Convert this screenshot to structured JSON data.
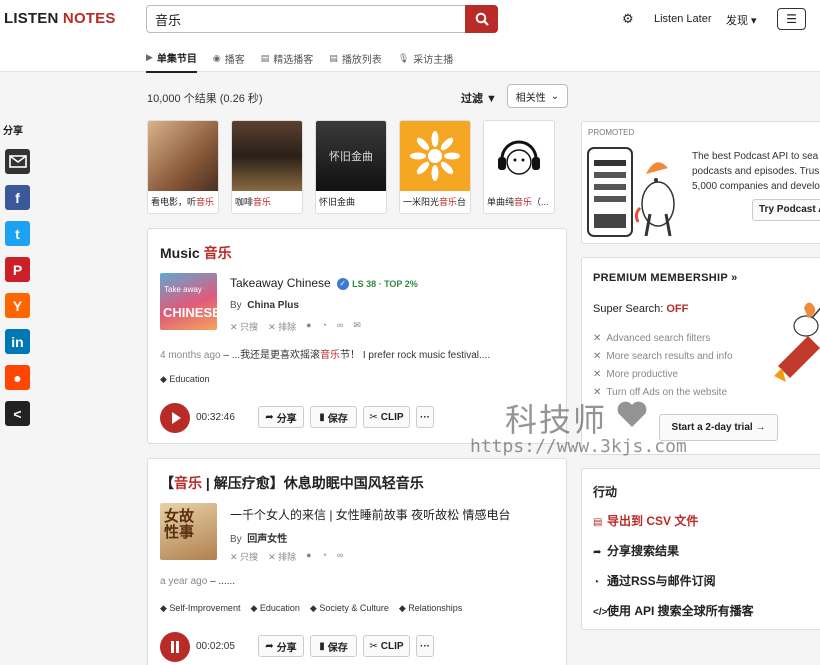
{
  "header": {
    "logo_a": "LISTEN ",
    "logo_b": "NOTES",
    "search_value": "音乐",
    "listen_later": "Listen Later",
    "discover": "发现 ▾",
    "menu": "☰"
  },
  "tabs": [
    {
      "label": "单集节目",
      "icon": "play-icon",
      "active": true
    },
    {
      "label": "播客",
      "icon": "podcast-icon"
    },
    {
      "label": "精选播客",
      "icon": "list-icon"
    },
    {
      "label": "播放列表",
      "icon": "playlist-icon"
    },
    {
      "label": "采访主播",
      "icon": "mic-icon"
    }
  ],
  "share": {
    "label": "分享",
    "items": [
      "email",
      "facebook",
      "twitter",
      "pinterest",
      "hackernews",
      "linkedin",
      "reddit",
      "share"
    ]
  },
  "results": {
    "count": "10,000 个结果 (0.26 秒)",
    "filter": "过滤 ▼",
    "sort": "相关性"
  },
  "thumbs": [
    {
      "pre": "看电影，听",
      "hl": "音乐",
      "post": ""
    },
    {
      "pre": "咖啡",
      "hl": "音乐",
      "post": ""
    },
    {
      "pre": "怀旧金曲",
      "hl": "",
      "post": ""
    },
    {
      "pre": "一米阳光",
      "hl": "音乐",
      "post": "台"
    },
    {
      "pre": "单曲纯",
      "hl": "音乐",
      "post": "（..."
    }
  ],
  "card1": {
    "title_pre": "Music ",
    "title_hl": "音乐",
    "podcast": "Takeaway Chinese",
    "badge": "LS 38 · TOP 2%",
    "by_label": "By",
    "author": "China Plus",
    "only": "只搜",
    "exclude": "排除",
    "ago": "4 months ago",
    "desc_pre": " – ...我还是更喜欢摇滚",
    "desc_hl": "音乐",
    "desc_post": "节！ I prefer rock music festival....",
    "tags": [
      "Education"
    ],
    "duration": "00:32:46",
    "share": "分享",
    "save": "保存",
    "clip": "CLIP",
    "more": "···"
  },
  "card2": {
    "title_pre": "【",
    "title_hl": "音乐",
    "title_post": " | 解压疗愈】休息助眠中国风轻音乐",
    "podcast": "一千个女人的来信 | 女性睡前故事 夜听故松 情感电台",
    "by_label": "By",
    "author": "回声女性",
    "only": "只搜",
    "exclude": "排除",
    "ago": "a year ago",
    "desc": " – ......",
    "tags": [
      "Self-Improvement",
      "Education",
      "Society & Culture",
      "Relationships"
    ],
    "duration": "00:02:05",
    "share": "分享",
    "save": "保存",
    "clip": "CLIP",
    "more": "···"
  },
  "promo": {
    "label": "PROMOTED",
    "line1": "The best Podcast API to sea",
    "line2": "podcasts and episodes. Trus",
    "line3": "5,000 companies and develo",
    "button": "Try Podcast A"
  },
  "premium": {
    "title": "PREMIUM MEMBERSHIP  »",
    "super_label": "Super Search: ",
    "super_value": "OFF",
    "features": [
      "Advanced search filters",
      "More search results and info",
      "More productive",
      "Turn off Ads on the website"
    ],
    "trial": "Start a 2-day trial →"
  },
  "actions": {
    "title": "行动",
    "items": [
      {
        "label": "导出到 CSV 文件",
        "icon": "export-icon",
        "red": true
      },
      {
        "label": "分享搜索结果",
        "icon": "share-icon"
      },
      {
        "label": "通过RSS与邮件订阅",
        "icon": "rss-icon"
      },
      {
        "label": "使用 API 搜索全球所有播客",
        "icon": "code-icon"
      }
    ]
  },
  "watermark": {
    "cn": "科技师",
    "url": "https://www.3kjs.com"
  }
}
